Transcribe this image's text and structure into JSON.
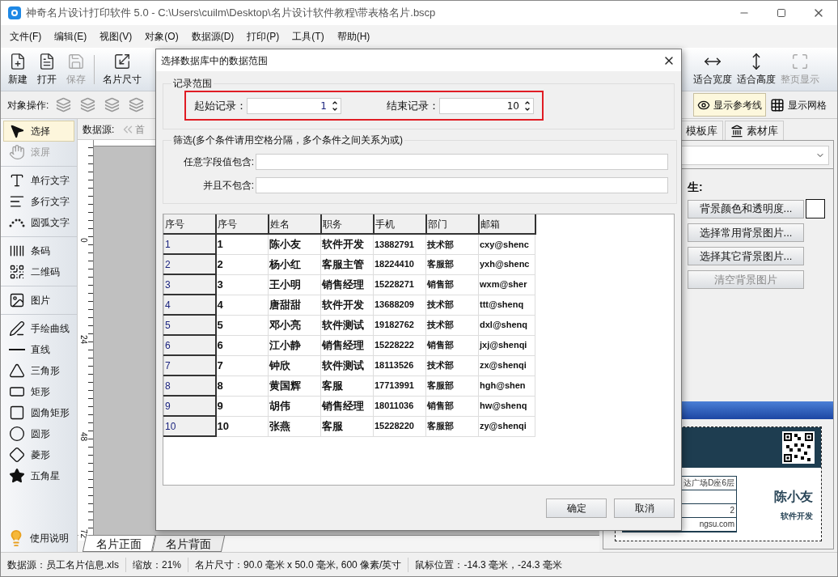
{
  "window": {
    "title": "神奇名片设计打印软件 5.0 - C:\\Users\\cuilm\\Desktop\\名片设计软件教程\\带表格名片.bscp"
  },
  "menu": [
    "文件(F)",
    "编辑(E)",
    "视图(V)",
    "对象(O)",
    "数据源(D)",
    "打印(P)",
    "工具(T)",
    "帮助(H)"
  ],
  "toolbar_left": [
    {
      "label": "新建",
      "kind": "new",
      "disabled": false
    },
    {
      "label": "打开",
      "kind": "open",
      "disabled": false
    },
    {
      "label": "保存",
      "kind": "save",
      "disabled": true
    },
    {
      "label": "名片尺寸",
      "kind": "size",
      "disabled": false
    }
  ],
  "toolbar_right": [
    {
      "label": "适合宽度",
      "kind": "fit_width",
      "disabled": false
    },
    {
      "label": "适合高度",
      "kind": "fit_height",
      "disabled": false
    },
    {
      "label": "整页显示",
      "kind": "full_page",
      "disabled": true
    }
  ],
  "object_ops": {
    "label": "对象操作:"
  },
  "view_toggles": [
    {
      "label": "显示参考线",
      "kind": "guides",
      "selected": true
    },
    {
      "label": "显示网格",
      "kind": "grid",
      "selected": false
    }
  ],
  "tool_groups": [
    [
      {
        "label": "选择",
        "kind": "pointer",
        "selected": true,
        "disabled": false
      },
      {
        "label": "滚屏",
        "kind": "hand",
        "selected": false,
        "disabled": true
      }
    ],
    [
      {
        "label": "单行文字",
        "kind": "text",
        "selected": false,
        "disabled": false
      },
      {
        "label": "多行文字",
        "kind": "multiline",
        "selected": false,
        "disabled": false
      },
      {
        "label": "圆弧文字",
        "kind": "arc",
        "selected": false,
        "disabled": false
      }
    ],
    [
      {
        "label": "条码",
        "kind": "barcode",
        "selected": false,
        "disabled": false
      },
      {
        "label": "二维码",
        "kind": "qr",
        "selected": false,
        "disabled": false
      }
    ],
    [
      {
        "label": "图片",
        "kind": "image",
        "selected": false,
        "disabled": false
      }
    ],
    [
      {
        "label": "手绘曲线",
        "kind": "pen",
        "selected": false,
        "disabled": false
      },
      {
        "label": "直线",
        "kind": "line",
        "selected": false,
        "disabled": false
      },
      {
        "label": "三角形",
        "kind": "triangle",
        "selected": false,
        "disabled": false
      },
      {
        "label": "矩形",
        "kind": "rect",
        "selected": false,
        "disabled": false
      },
      {
        "label": "圆角矩形",
        "kind": "roundrect",
        "selected": false,
        "disabled": false
      },
      {
        "label": "圆形",
        "kind": "ellipse",
        "selected": false,
        "disabled": false
      },
      {
        "label": "菱形",
        "kind": "diamond",
        "selected": false,
        "disabled": false
      },
      {
        "label": "五角星",
        "kind": "star",
        "selected": false,
        "disabled": false
      }
    ]
  ],
  "help": {
    "label": "使用说明"
  },
  "datasource_bar": {
    "label": "数据源:",
    "first": "首"
  },
  "ruler_marks": [
    "0",
    "24",
    "48",
    "72"
  ],
  "page_tabs": [
    {
      "label": "名片正面",
      "selected": true
    },
    {
      "label": "名片背面",
      "selected": false
    }
  ],
  "right_panel": {
    "tabs": [
      {
        "label": "模板库",
        "selected": false
      },
      {
        "label": "素材库",
        "selected": false
      }
    ],
    "heading": "生:",
    "buttons": [
      {
        "label": "背景颜色和透明度...",
        "disabled": false
      },
      {
        "label": "选择常用背景图片...",
        "disabled": false
      },
      {
        "label": "选择其它背景图片...",
        "disabled": false
      },
      {
        "label": "清空背景图片",
        "disabled": true
      }
    ],
    "card": {
      "name": "陈小友",
      "title": "软件开发",
      "rows": [
        {
          "text": "达广场D座6层"
        },
        {},
        {
          "text": "2"
        },
        {
          "text": "ngsu.com"
        }
      ]
    }
  },
  "status_bar": [
    "数据源：员工名片信息.xls",
    "缩放：21%",
    "名片尺寸：90.0 毫米 x 50.0 毫米, 600 像素/英寸",
    "鼠标位置：-14.3 毫米，-24.3 毫米"
  ],
  "dialog": {
    "title": "选择数据库中的数据范围",
    "range": {
      "legend": "记录范围",
      "highlighted": true,
      "start_label": "起始记录：",
      "start": "1",
      "end_label": "结束记录：",
      "end": "10"
    },
    "filter": {
      "legend": "筛选(多个条件请用空格分隔，多个条件之间关系为或)",
      "contains_label": "任意字段值包含:",
      "excludes_label": "并且不包含:"
    },
    "columns": [
      "序号",
      "序号",
      "姓名",
      "职务",
      "手机",
      "部门",
      "邮箱"
    ],
    "rows": [
      [
        "1",
        "1",
        "陈小友",
        "软件开发",
        "13882791",
        "技术部",
        "cxy@shenc"
      ],
      [
        "2",
        "2",
        "杨小红",
        "客服主管",
        "18224410",
        "客服部",
        "yxh@shenc"
      ],
      [
        "3",
        "3",
        "王小明",
        "销售经理",
        "15228271",
        "销售部",
        "wxm@sher"
      ],
      [
        "4",
        "4",
        "唐甜甜",
        "软件开发",
        "13688209",
        "技术部",
        "ttt@shenq"
      ],
      [
        "5",
        "5",
        "邓小亮",
        "软件测试",
        "19182762",
        "技术部",
        "dxl@shenq"
      ],
      [
        "6",
        "6",
        "江小静",
        "销售经理",
        "15228222",
        "销售部",
        "jxj@shenqi"
      ],
      [
        "7",
        "7",
        "钟欣",
        "软件测试",
        "18113526",
        "技术部",
        "zx@shenqi"
      ],
      [
        "8",
        "8",
        "黄国辉",
        "客服",
        "17713991",
        "客服部",
        "hgh@shen"
      ],
      [
        "9",
        "9",
        "胡伟",
        "销售经理",
        "18011036",
        "销售部",
        "hw@shenq"
      ],
      [
        "10",
        "10",
        "张燕",
        "客服",
        "15228220",
        "客服部",
        "zy@shenqi"
      ]
    ],
    "buttons": [
      "确定",
      "取消"
    ]
  }
}
